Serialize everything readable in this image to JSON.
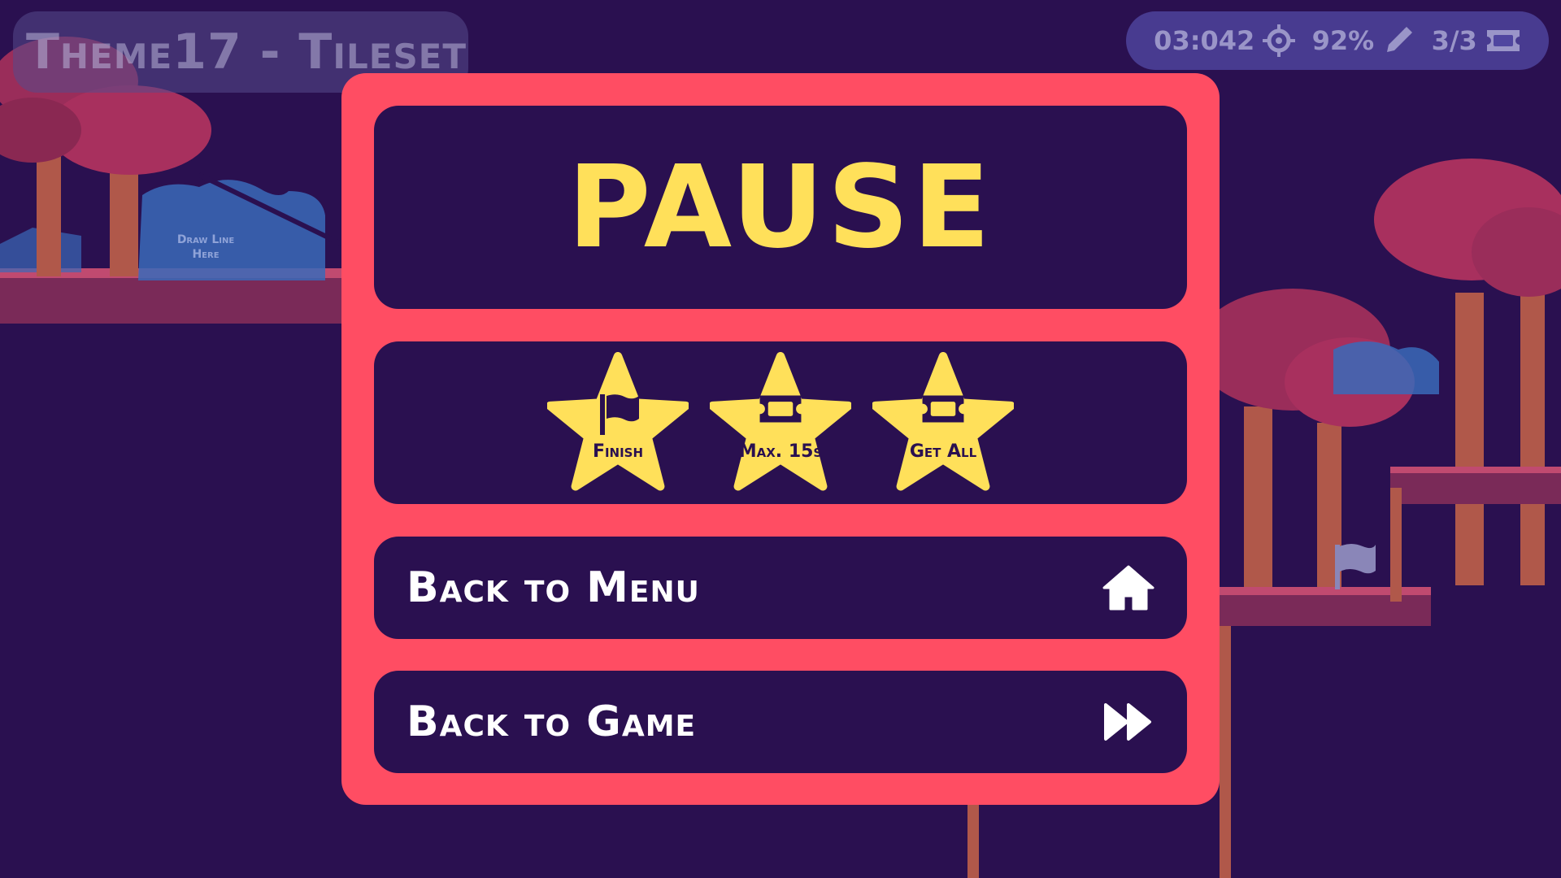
{
  "level_title": "Theme17 - Tileset",
  "hud": {
    "timer": "03:042",
    "accuracy": "92%",
    "tickets": "3/3"
  },
  "hint": {
    "line1": "Draw Line",
    "line2": "Here"
  },
  "pause": {
    "title": "PAUSE",
    "stars": [
      {
        "label": "Finish",
        "icon": "flag-icon"
      },
      {
        "label": "Max. 15s",
        "icon": "ticket-icon"
      },
      {
        "label": "Get All",
        "icon": "ticket-icon"
      }
    ],
    "buttons": {
      "menu": "Back to Menu",
      "game": "Back to Game"
    }
  },
  "colors": {
    "background": "#2a1050",
    "frame": "#ff4d63",
    "accent": "#ffe05a",
    "hud_text": "#9a95c8"
  }
}
